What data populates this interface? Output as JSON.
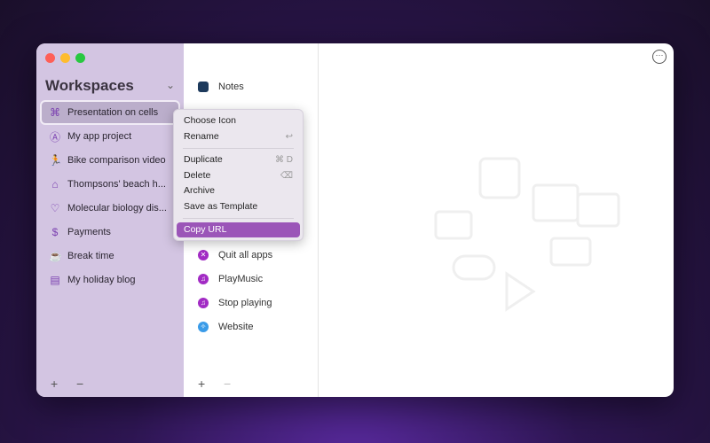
{
  "sidebar": {
    "title": "Workspaces",
    "items": [
      {
        "label": "Presentation on cells",
        "icon": "command-icon"
      },
      {
        "label": "My app project",
        "icon": "a-square-icon"
      },
      {
        "label": "Bike comparison video",
        "icon": "runner-icon"
      },
      {
        "label": "Thompsons' beach h...",
        "icon": "house-icon"
      },
      {
        "label": "Molecular biology dis...",
        "icon": "heart-pulse-icon"
      },
      {
        "label": "Payments",
        "icon": "dollar-circle-icon"
      },
      {
        "label": "Break time",
        "icon": "coffee-icon"
      },
      {
        "label": "My holiday blog",
        "icon": "newspaper-icon"
      }
    ],
    "add": "+",
    "remove": "−"
  },
  "list": {
    "items": [
      {
        "label": "Notes",
        "icon": "notes-app-icon"
      },
      {
        "label": "Quit all apps",
        "icon": "x-circle-icon"
      },
      {
        "label": "PlayMusic",
        "icon": "music-icon"
      },
      {
        "label": "Stop playing",
        "icon": "music-icon"
      },
      {
        "label": "Website",
        "icon": "safari-icon"
      }
    ],
    "add": "+",
    "remove": "−"
  },
  "context_menu": {
    "items": [
      {
        "label": "Choose Icon",
        "shortcut": ""
      },
      {
        "label": "Rename",
        "shortcut": "↩"
      },
      {
        "label": "Duplicate",
        "shortcut": "⌘ D"
      },
      {
        "label": "Delete",
        "shortcut": "⌫"
      },
      {
        "label": "Archive",
        "shortcut": ""
      },
      {
        "label": "Save as Template",
        "shortcut": ""
      },
      {
        "label": "Copy URL",
        "shortcut": ""
      }
    ],
    "highlighted": "Copy URL"
  },
  "more_button": "⋯",
  "colors": {
    "sidebar": "#d3c5e2",
    "accent": "#9b55b8"
  }
}
